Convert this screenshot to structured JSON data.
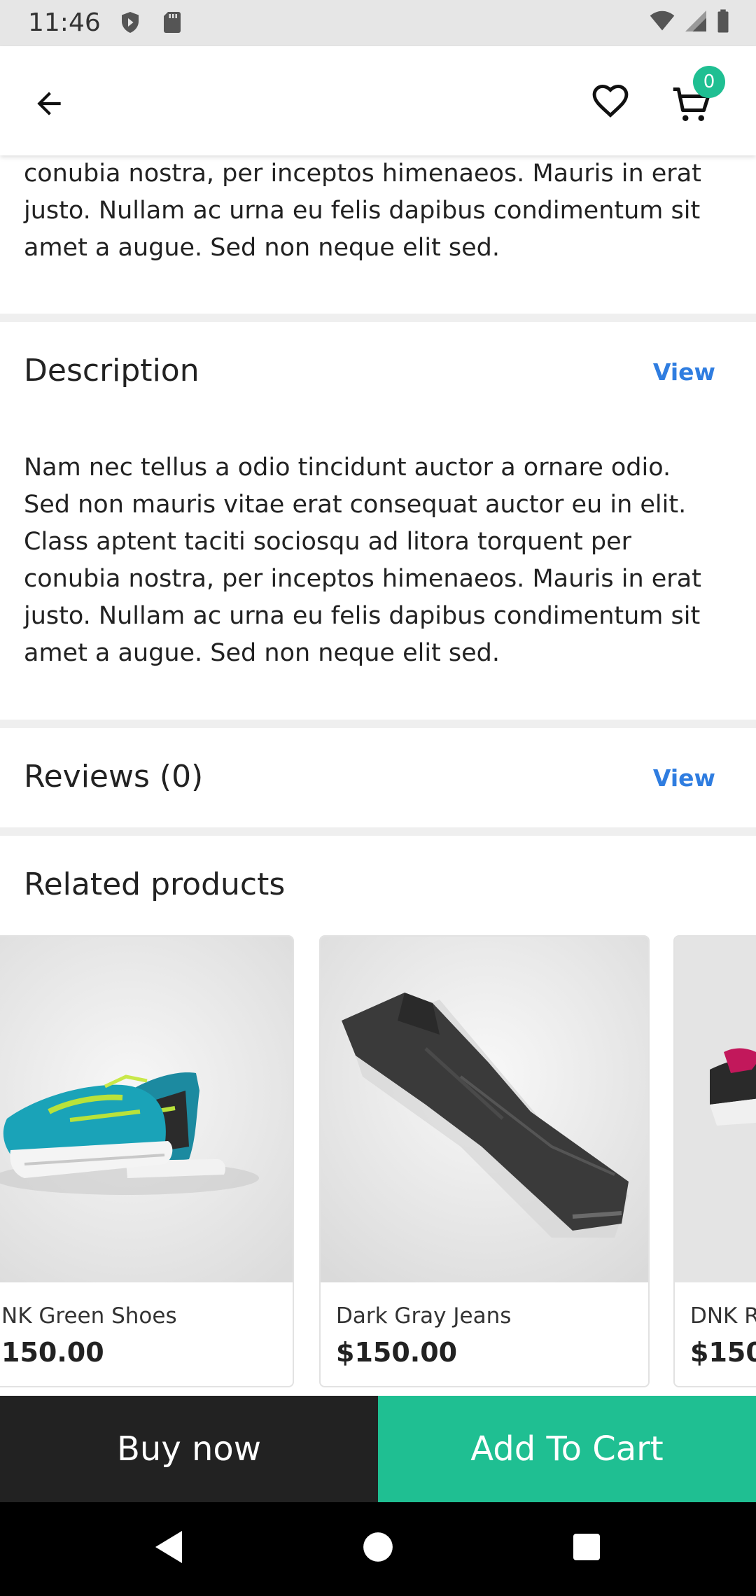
{
  "status_bar": {
    "time": "11:46",
    "icons": [
      "shield-icon",
      "sd-card-icon",
      "wifi-icon",
      "signal-icon",
      "battery-icon"
    ]
  },
  "app_bar": {
    "icons": [
      "back-arrow-icon",
      "heart-icon",
      "cart-icon"
    ],
    "cart_count": "0",
    "accent_color": "#1fbf92"
  },
  "short_description": {
    "lines": [
      "conubia nostra, per inceptos himenaeos. Mauris in erat",
      "justo. Nullam ac urna eu felis dapibus condimentum sit",
      "amet a augue. Sed non neque elit sed."
    ]
  },
  "description": {
    "title": "Description",
    "view_label": "View",
    "lines": [
      "Nam nec tellus a odio tincidunt auctor a ornare odio.",
      "Sed non mauris vitae erat consequat auctor eu in elit.",
      "Class aptent taciti sociosqu ad litora torquent per",
      "conubia nostra, per inceptos himenaeos. Mauris in erat",
      "justo. Nullam ac urna eu felis dapibus condimentum sit",
      "amet a augue. Sed non neque elit sed."
    ]
  },
  "reviews": {
    "title": "Reviews (0)",
    "view_label": "View"
  },
  "related": {
    "title": "Related products",
    "products": [
      {
        "name": "NK Green Shoes",
        "price": "150.00"
      },
      {
        "name": "Dark Gray Jeans",
        "price": "$150.00"
      },
      {
        "name": "DNK R",
        "price": "$150"
      }
    ]
  },
  "actions": {
    "buy_now": "Buy now",
    "add_to_cart": "Add To Cart",
    "buy_color": "#222222",
    "cart_color": "#1fbf92"
  },
  "nav_bar": {
    "icons": [
      "nav-back-icon",
      "nav-home-icon",
      "nav-recents-icon"
    ]
  }
}
